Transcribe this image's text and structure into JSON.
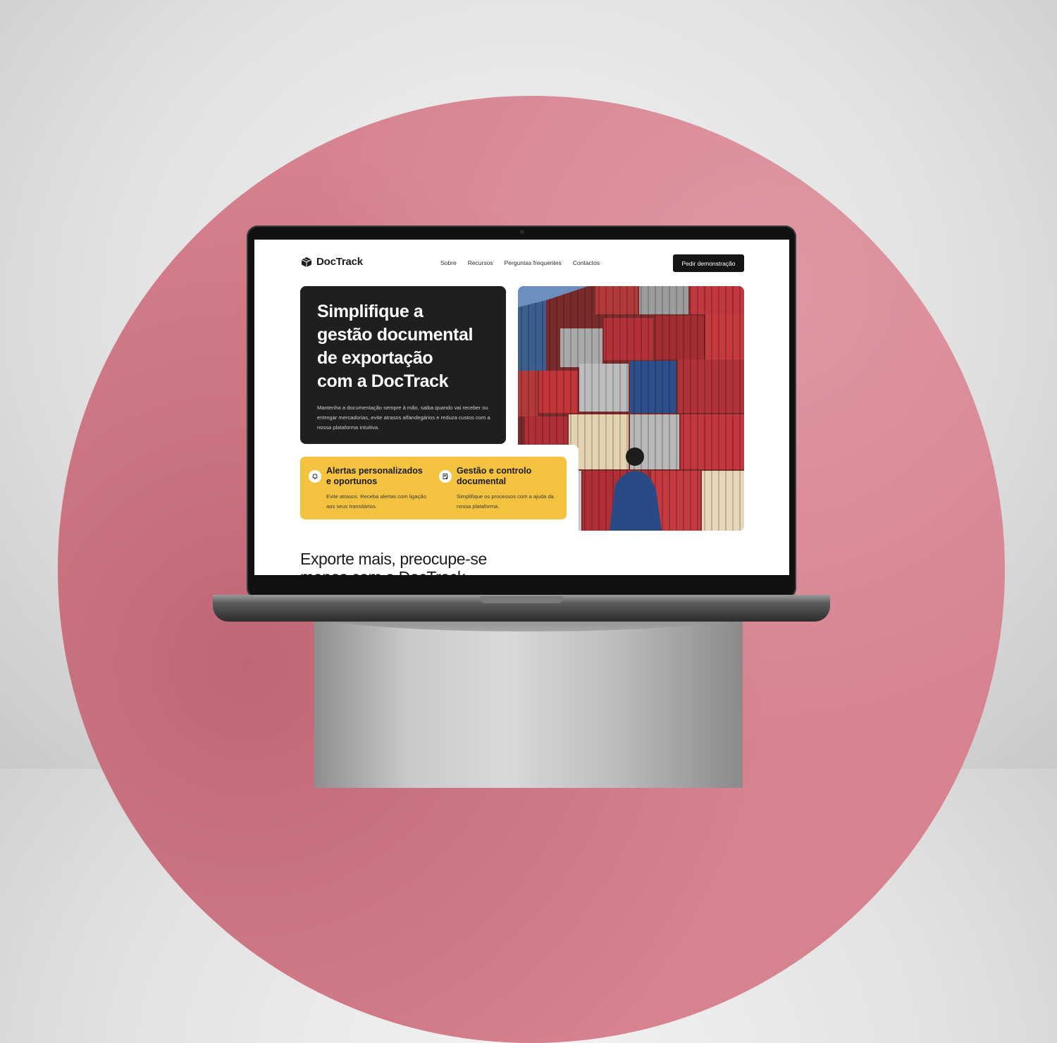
{
  "brand": {
    "name": "DocTrack",
    "logo_icon": "box-icon"
  },
  "nav": {
    "items": [
      {
        "label": "Sobre"
      },
      {
        "label": "Recursos"
      },
      {
        "label": "Perguntas frequentes"
      },
      {
        "label": "Contactos"
      }
    ],
    "cta_label": "Pedir demonstração"
  },
  "hero": {
    "title": "Simplifique a\ngestão documental\nde exportação\ncom a DocTrack",
    "description": "Mantenha a documentação sempre à mão, saiba quando vai receber ou entregar mercadorias, evite atrasos alfandegários e reduza custos com a nossa plataforma intuitiva.",
    "image": "shipping-containers-photo"
  },
  "features": [
    {
      "icon": "bell-icon",
      "title": "Alertas personalizados\ne oportunos",
      "description": "Evite atrasos. Receba alertas com ligação aos seus transitários."
    },
    {
      "icon": "document-edit-icon",
      "title": "Gestão e controlo\ndocumental",
      "description": "Simplifique os processos com a ajuda da nossa plataforma."
    }
  ],
  "section": {
    "title": "Exporte mais, preocupe-se\nmenos com a DocTrack"
  },
  "colors": {
    "accent": "#f3c23e",
    "dark": "#1f1f1f",
    "backdrop": "#d7828f"
  }
}
